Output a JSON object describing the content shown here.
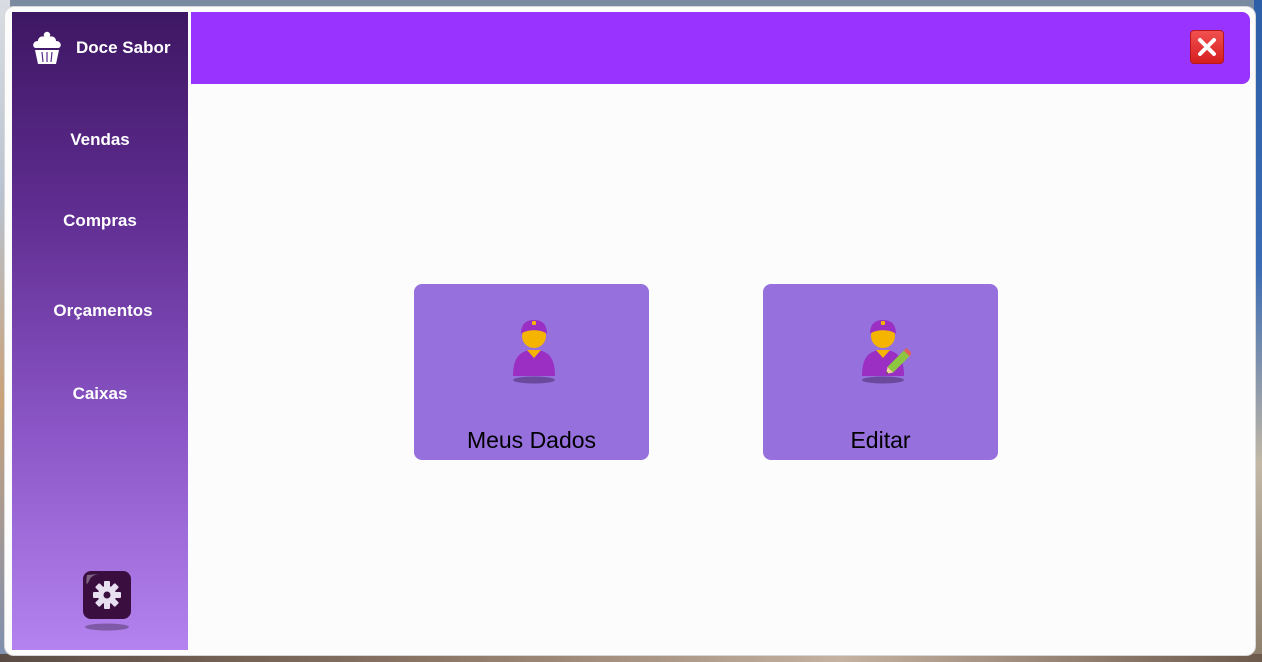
{
  "app": {
    "name": "Doce Sabor",
    "brand_icon": "cupcake-icon"
  },
  "sidebar": {
    "items": [
      {
        "label": "Vendas"
      },
      {
        "label": "Compras"
      },
      {
        "label": "Orçamentos"
      },
      {
        "label": "Caixas"
      }
    ],
    "settings_icon": "gear-icon"
  },
  "topbar": {
    "close_icon": "close-icon"
  },
  "main": {
    "cards": [
      {
        "label": "Meus Dados",
        "icon": "user-icon"
      },
      {
        "label": "Editar",
        "icon": "user-edit-icon"
      }
    ]
  },
  "colors": {
    "topbar": "#9933ff",
    "card": "#9670dd",
    "sidebar_top": "#3e1763",
    "sidebar_bottom": "#b483ef",
    "close": "#e53535"
  }
}
